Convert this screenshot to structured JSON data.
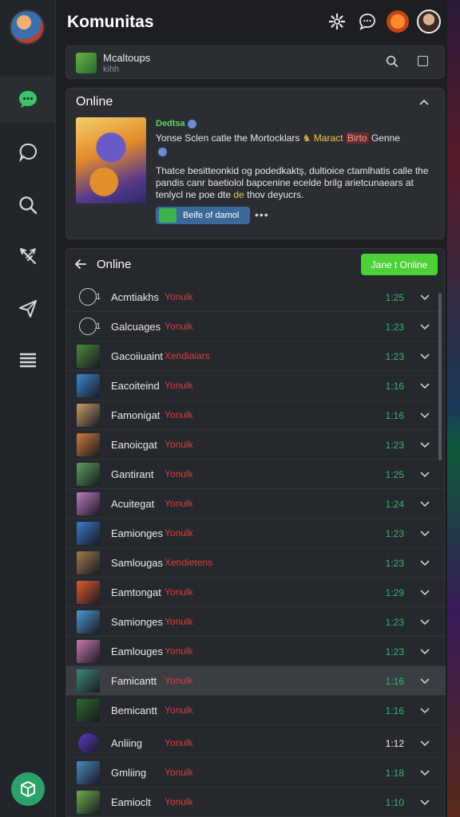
{
  "app": {
    "title": "Komunitas"
  },
  "topbar": {
    "icons": [
      "gear-icon",
      "chat-bubble-icon",
      "coin-icon",
      "user-avatar"
    ]
  },
  "sidebar": {
    "items": [
      {
        "icon": "chat-icon",
        "active": true
      },
      {
        "icon": "bubble-icon",
        "active": false
      },
      {
        "icon": "search-icon",
        "active": false
      },
      {
        "icon": "sword-icon",
        "active": false
      },
      {
        "icon": "send-icon",
        "active": false
      },
      {
        "icon": "menu-icon",
        "active": false
      }
    ],
    "fab_icon": "cube-icon"
  },
  "group": {
    "name": "Mcaltoups",
    "sub": "kihh"
  },
  "online_section": {
    "title": "Online",
    "post": {
      "author": "Dedtsa",
      "line1_a": "Yonse Sclen catle the Mortocklars",
      "line1_b": "Maract",
      "line1_tag": "Birto",
      "line1_c": "Genne",
      "body_a": "Thatce besitteonkid og podedkaktş, dultioice ctamlhatis calle the pandis canr baetiolol bapcenine ecelde brilg arietcunaears at tenlycl ne poe dte",
      "body_hl": "de",
      "body_b": "thov deyucrs.",
      "button_label": "Beife of damol",
      "more": "•••"
    }
  },
  "list": {
    "title": "Online",
    "join_label": "Jane t Online",
    "rows": [
      {
        "name": "Acmtiakhs",
        "status": "Yonulk",
        "time": "1:25",
        "idx": "1",
        "avatar": "outline",
        "color": "",
        "time_color": "green"
      },
      {
        "name": "Galcuages",
        "status": "Yonulk",
        "time": "1:23",
        "idx": "1",
        "avatar": "outline",
        "color": "",
        "time_color": "green"
      },
      {
        "name": "Gacoiiuaint",
        "status": "Xendiaiars",
        "time": "1:23",
        "idx": "",
        "avatar": "square",
        "color": "#4a8a3a",
        "time_color": "green"
      },
      {
        "name": "Eacoiteind",
        "status": "Yonulk",
        "time": "1:16",
        "idx": "",
        "avatar": "square",
        "color": "#3a8ad0",
        "time_color": "green"
      },
      {
        "name": "Famonigat",
        "status": "Yonulk",
        "time": "1:16",
        "idx": "",
        "avatar": "square",
        "color": "#c89a6a",
        "time_color": "green"
      },
      {
        "name": "Eanoicgat",
        "status": "Yonulk",
        "time": "1:23",
        "idx": "",
        "avatar": "square",
        "color": "#d07a3a",
        "time_color": "green"
      },
      {
        "name": "Gantirant",
        "status": "Yonulk",
        "time": "1:25",
        "idx": "",
        "avatar": "square",
        "color": "#5aa05a",
        "time_color": "green"
      },
      {
        "name": "Acuitegat",
        "status": "Yonulk",
        "time": "1:24",
        "idx": "",
        "avatar": "square",
        "color": "#c07ac0",
        "time_color": "green"
      },
      {
        "name": "Eamionges",
        "status": "Yonulk",
        "time": "1:23",
        "idx": "",
        "avatar": "square",
        "color": "#3a7ac8",
        "time_color": "green"
      },
      {
        "name": "Samlougas",
        "status": "Xendietens",
        "time": "1:23",
        "idx": "",
        "avatar": "square",
        "color": "#a07a4a",
        "time_color": "green"
      },
      {
        "name": "Eamtongat",
        "status": "Yonulk",
        "time": "1:29",
        "idx": "",
        "avatar": "square",
        "color": "#e05a2a",
        "time_color": "green"
      },
      {
        "name": "Samionges",
        "status": "Yonulk",
        "time": "1:23",
        "idx": "",
        "avatar": "square",
        "color": "#4a9ad0",
        "time_color": "green"
      },
      {
        "name": "Eamlouges",
        "status": "Yonulk",
        "time": "1:23",
        "idx": "",
        "avatar": "square",
        "color": "#c87ab0",
        "time_color": "green"
      },
      {
        "name": "Famicantt",
        "status": "Yonulk",
        "time": "1:16",
        "idx": "",
        "avatar": "square",
        "color": "#3a8a7a",
        "time_color": "green",
        "selected": true
      },
      {
        "name": "Bemicantt",
        "status": "Yonulk",
        "time": "1:16",
        "idx": "",
        "avatar": "square",
        "color": "#2a6a2a",
        "time_color": "green"
      },
      {
        "name": "Anliing",
        "status": "Yonulk",
        "time": "1:12",
        "idx": "",
        "avatar": "round",
        "color": "#5a3ac8",
        "time_color": "white",
        "sep": true
      },
      {
        "name": "Gmliing",
        "status": "Yonulk",
        "time": "1:18",
        "idx": "",
        "avatar": "square",
        "color": "#4a8ac0",
        "time_color": "green"
      },
      {
        "name": "Eamioclt",
        "status": "Yonulk",
        "time": "1:10",
        "idx": "",
        "avatar": "square",
        "color": "#6ab04a",
        "time_color": "green"
      }
    ]
  },
  "colors": {
    "accent_green": "#4cd137",
    "status_red": "#e03a3a",
    "time_green": "#3cb371",
    "background": "#1c1e22"
  }
}
